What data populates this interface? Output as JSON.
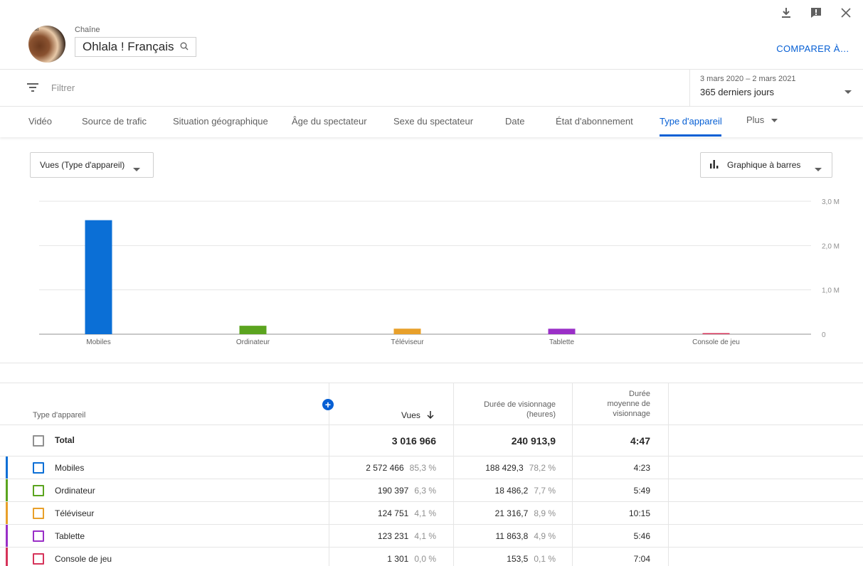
{
  "header": {
    "channel_label": "Chaîne",
    "channel_name": "Ohlala ! Français",
    "compare_label": "COMPARER À…",
    "icons": [
      "download-icon",
      "feedback-icon",
      "close-icon"
    ]
  },
  "filter": {
    "placeholder": "Filtrer",
    "date_range": "3 mars 2020 – 2 mars 2021",
    "date_period": "365 derniers jours"
  },
  "tabs": [
    {
      "label": "Vidéo"
    },
    {
      "label": "Source de trafic"
    },
    {
      "label": "Situation géographique"
    },
    {
      "label": "Âge du spectateur"
    },
    {
      "label": "Sexe du spectateur"
    },
    {
      "label": "Date"
    },
    {
      "label": "État d'abonnement"
    },
    {
      "label": "Type d'appareil",
      "active": true
    },
    {
      "label": "Plus"
    }
  ],
  "controls": {
    "metric": "Vues (Type d'appareil)",
    "chart_type": "Graphique à barres"
  },
  "chart_data": {
    "type": "bar",
    "categories": [
      "Mobiles",
      "Ordinateur",
      "Téléviseur",
      "Tablette",
      "Console de jeu"
    ],
    "values": [
      2572466,
      190397,
      124751,
      123231,
      1301
    ],
    "colors": [
      "#0b6fd6",
      "#5ba41f",
      "#e8a02a",
      "#9a2fc7",
      "#d6335a"
    ],
    "ylim": [
      0,
      3000000
    ],
    "yticks": [
      "0",
      "1,0 M",
      "2,0 M",
      "3,0 M"
    ],
    "ytick_values": [
      0,
      1000000,
      2000000,
      3000000
    ]
  },
  "table": {
    "headers": {
      "device": "Type d'appareil",
      "views": "Vues",
      "watch_time_1": "Durée de visionnage",
      "watch_time_2": "(heures)",
      "avg_1": "Durée",
      "avg_2": "moyenne de",
      "avg_3": "visionnage"
    },
    "total": {
      "label": "Total",
      "views": "3 016 966",
      "watch": "240 913,9",
      "avg": "4:47"
    },
    "rows": [
      {
        "name": "Mobiles",
        "views": "2 572 466",
        "views_pct": "85,3 %",
        "watch": "188 429,3",
        "watch_pct": "78,2 %",
        "avg": "4:23",
        "color": "#0b6fd6"
      },
      {
        "name": "Ordinateur",
        "views": "190 397",
        "views_pct": "6,3 %",
        "watch": "18 486,2",
        "watch_pct": "7,7 %",
        "avg": "5:49",
        "color": "#5ba41f"
      },
      {
        "name": "Téléviseur",
        "views": "124 751",
        "views_pct": "4,1 %",
        "watch": "21 316,7",
        "watch_pct": "8,9 %",
        "avg": "10:15",
        "color": "#e8a02a"
      },
      {
        "name": "Tablette",
        "views": "123 231",
        "views_pct": "4,1 %",
        "watch": "11 863,8",
        "watch_pct": "4,9 %",
        "avg": "5:46",
        "color": "#9a2fc7"
      },
      {
        "name": "Console de jeu",
        "views": "1 301",
        "views_pct": "0,0 %",
        "watch": "153,5",
        "watch_pct": "0,1 %",
        "avg": "7:04",
        "color": "#d6335a"
      }
    ]
  }
}
